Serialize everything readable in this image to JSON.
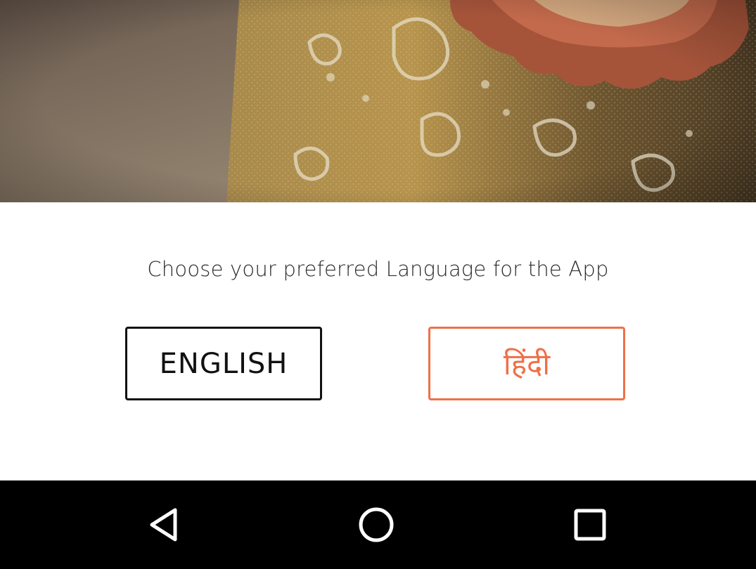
{
  "hero": {
    "icon": "diya-lamp-photo"
  },
  "language_picker": {
    "prompt": "Choose your preferred Language for the App",
    "english_label": "ENGLISH",
    "hindi_label": "हिंदी",
    "colors": {
      "english_border": "#111111",
      "hindi_accent": "#ef7048"
    }
  },
  "nav_bar": {
    "back_icon": "back-triangle-icon",
    "home_icon": "home-circle-icon",
    "recents_icon": "recents-square-icon",
    "background": "#000000"
  }
}
